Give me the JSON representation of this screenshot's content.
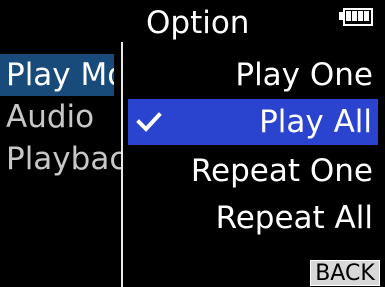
{
  "header": {
    "title": "Option",
    "battery_icon": "battery-icon"
  },
  "sidebar": {
    "items": [
      {
        "label": "Play Mode",
        "active": true
      },
      {
        "label": "Audio",
        "active": false
      },
      {
        "label": "Playback",
        "active": false
      }
    ]
  },
  "options": [
    {
      "label": "Play One",
      "selected": false
    },
    {
      "label": "Play All",
      "selected": true,
      "icon": "check-icon"
    },
    {
      "label": "Repeat One",
      "selected": false
    },
    {
      "label": "Repeat All",
      "selected": false
    }
  ],
  "back_label": "BACK",
  "colors": {
    "selection": "#2a44d0",
    "sidebar_active": "#184a7a",
    "background": "#000000",
    "text": "#ffffff"
  }
}
